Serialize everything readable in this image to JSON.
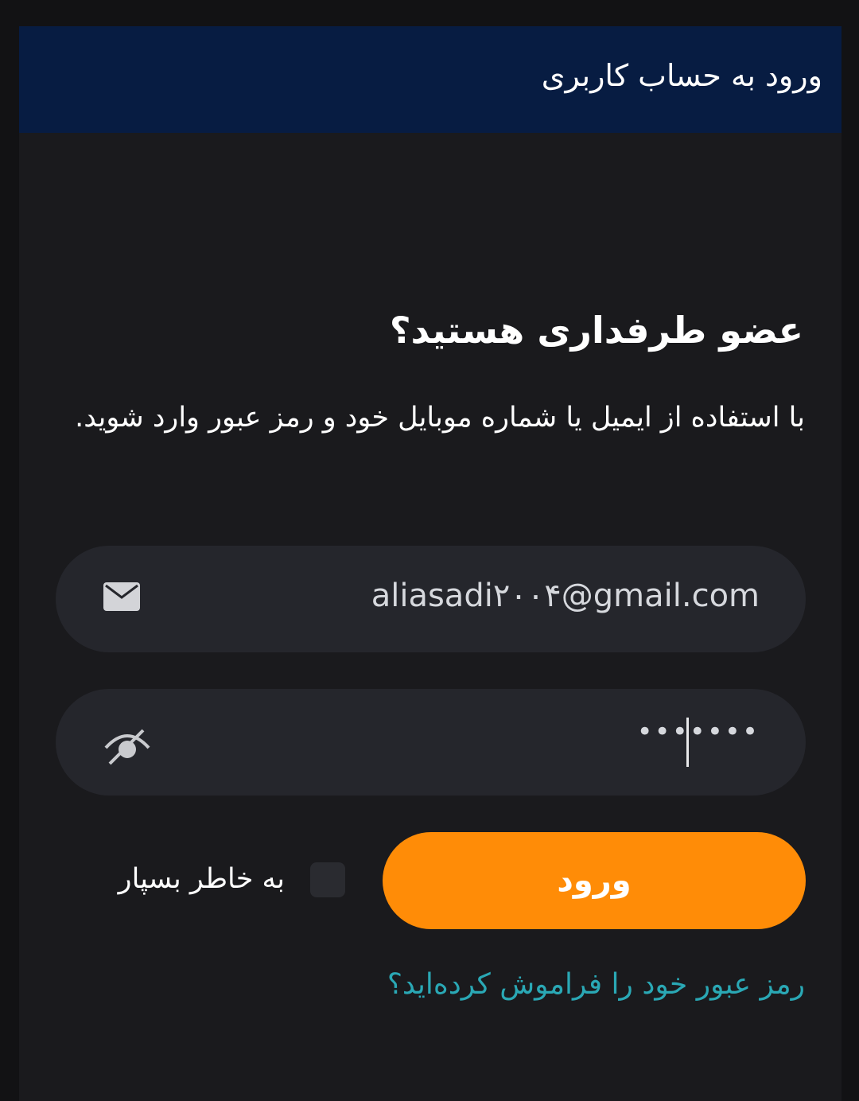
{
  "header": {
    "title": "ورود به حساب کاربری"
  },
  "form": {
    "heading": "عضو طرفداری هستید؟",
    "subtitle": "با استفاده از ایمیل یا شماره موبایل خود و رمز عبور وارد شوید.",
    "email_value": "aliasadi۲۰۰۴@gmail.com",
    "email_icon": "mail-icon",
    "password_value": "•••••••",
    "password_icon": "eye-off-icon",
    "login_label": "ورود",
    "remember_label": "به خاطر بسپار",
    "remember_checked": false,
    "forgot_link": "رمز عبور خود را فراموش کرده‌اید؟"
  },
  "colors": {
    "header_bg": "#071c42",
    "accent": "#ff8c07",
    "link": "#2aa8b5"
  }
}
